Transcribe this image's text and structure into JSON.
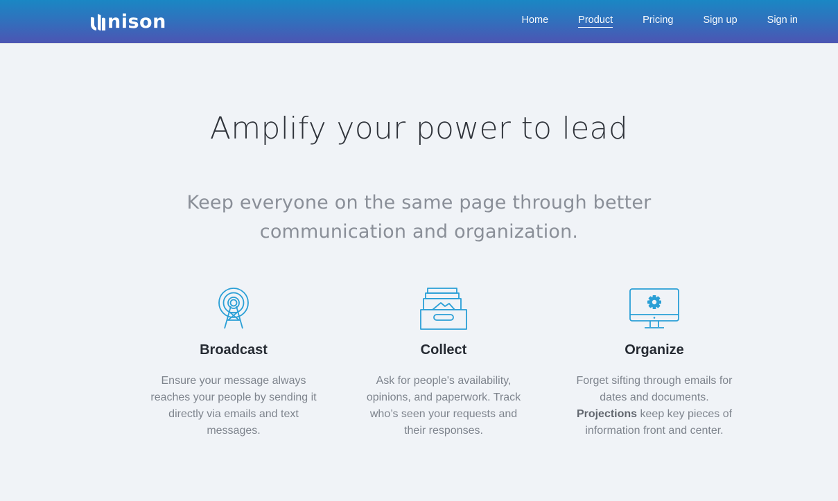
{
  "brand": {
    "name": "nison",
    "logo_icon": "unison-u-logo"
  },
  "nav": {
    "items": [
      {
        "label": "Home",
        "active": false
      },
      {
        "label": "Product",
        "active": true
      },
      {
        "label": "Pricing",
        "active": false
      },
      {
        "label": "Sign up",
        "active": false
      },
      {
        "label": "Sign in",
        "active": false
      }
    ]
  },
  "hero": {
    "title": "Amplify your power to lead",
    "subtitle_line1": "Keep everyone on the same page through better",
    "subtitle_line2": "communication and organization."
  },
  "features": [
    {
      "title": "Broadcast",
      "icon": "broadcast-tower-icon",
      "description": "Ensure your message always reaches your people by sending it directly via emails and text messages."
    },
    {
      "title": "Collect",
      "icon": "archive-box-icon",
      "description": "Ask for people's availability, opinions, and paperwork. Track who’s seen your requests and their responses."
    },
    {
      "title": "Organize",
      "icon": "monitor-gear-icon",
      "description_prefix": "Forget sifting through emails for dates and documents.",
      "description_bold": "Projections",
      "description_suffix": "keep key pieces of information front and center."
    }
  ],
  "colors": {
    "header_gradient_top": "#1a87c4",
    "header_gradient_bottom": "#4c55b3",
    "background": "#f0f3f7",
    "icon_stroke": "#2a9fd6"
  }
}
